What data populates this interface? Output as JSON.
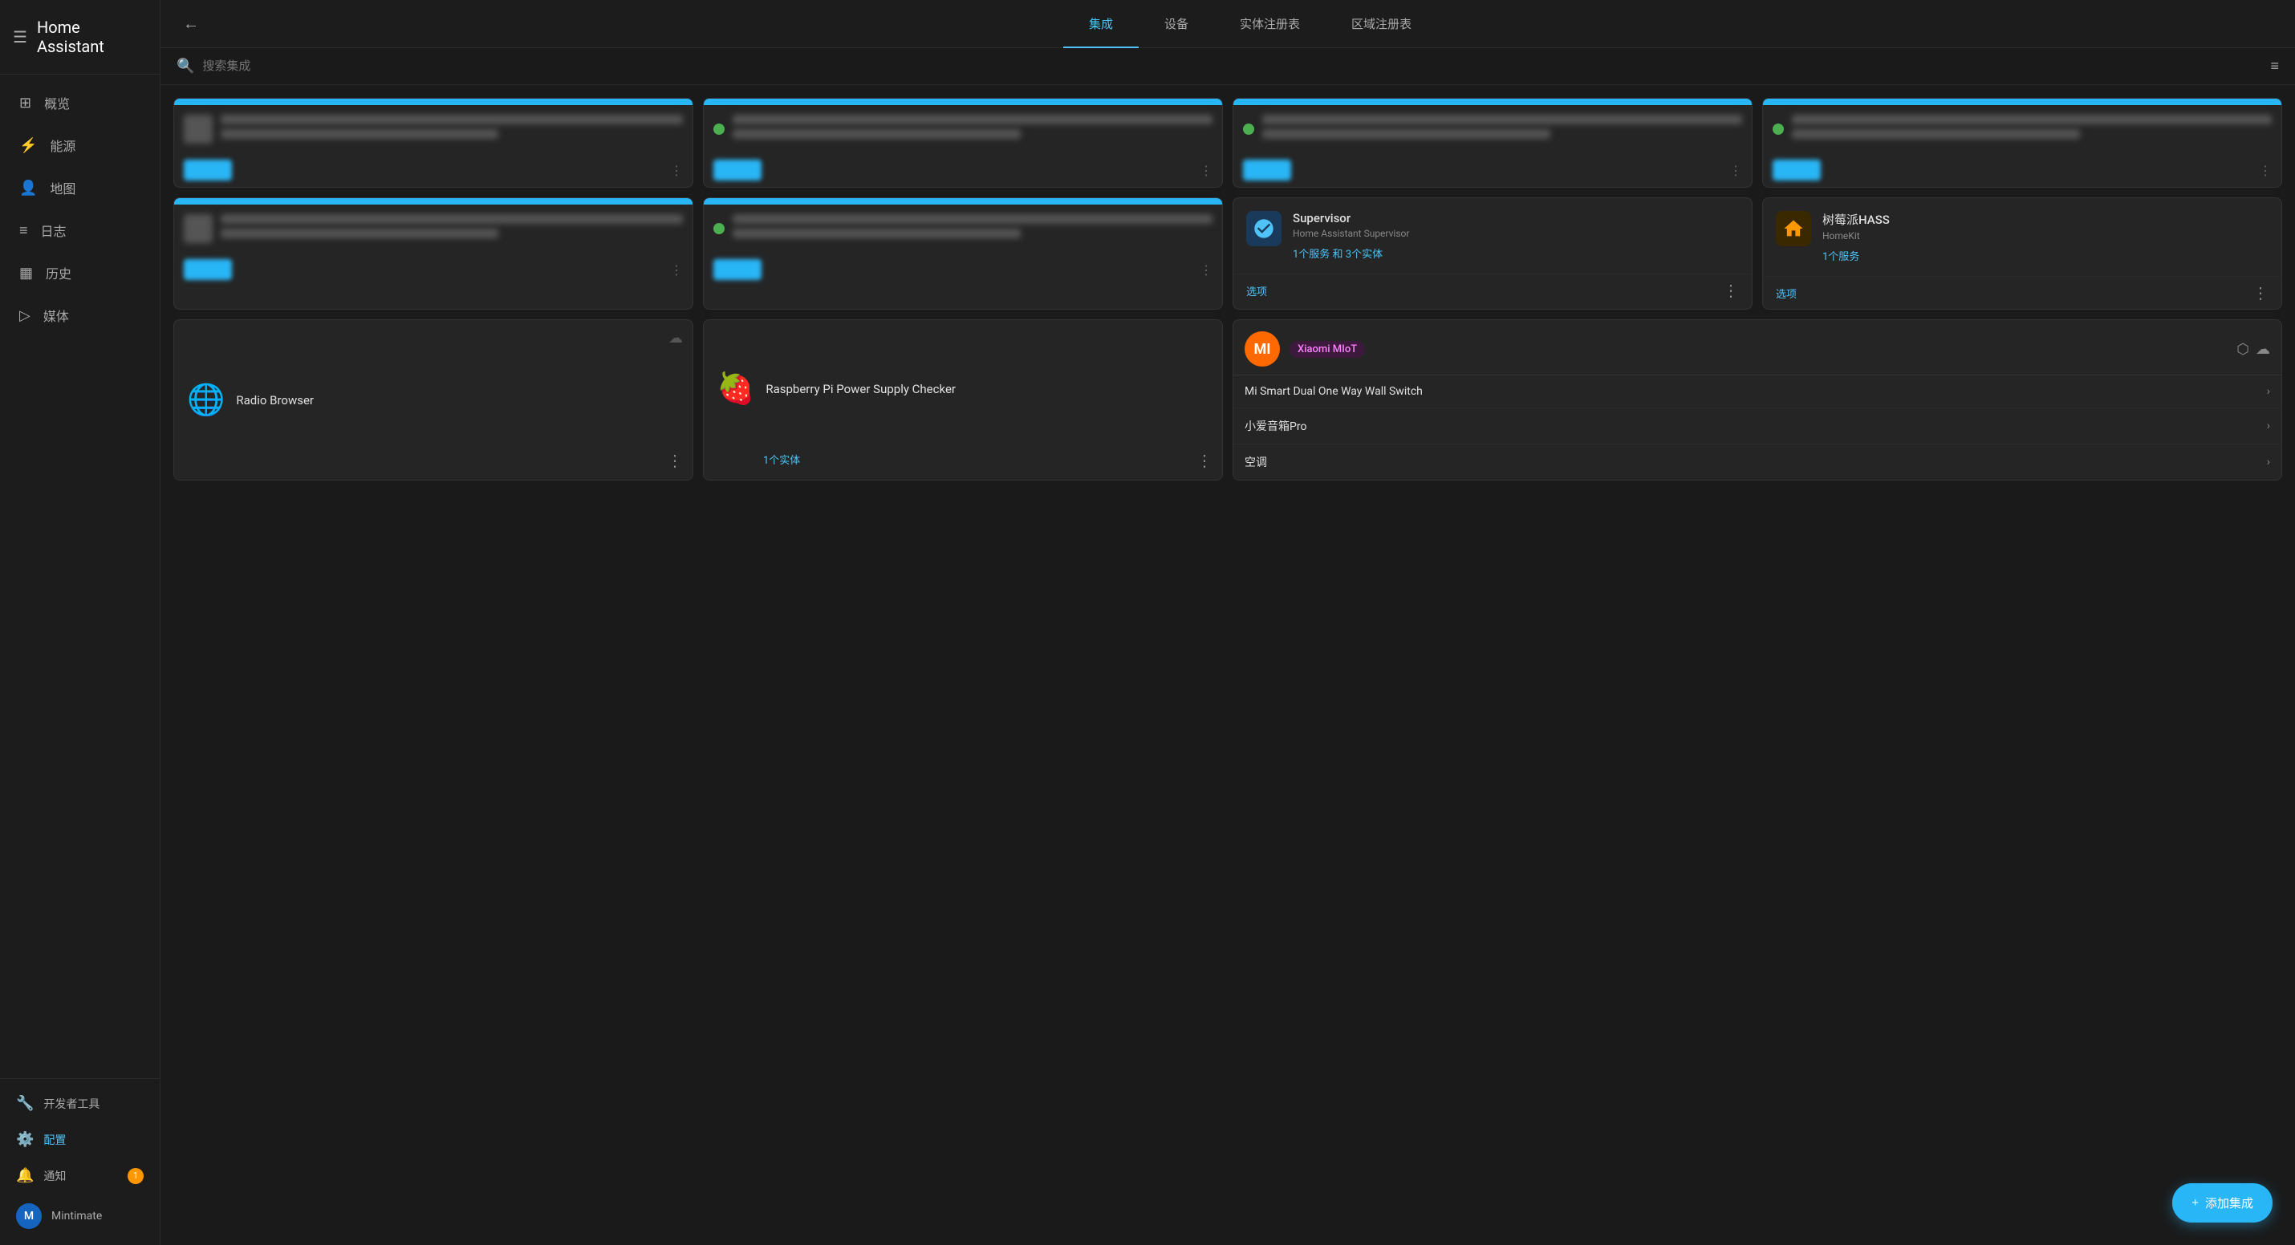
{
  "app": {
    "title": "Home Assistant"
  },
  "sidebar": {
    "menu_icon": "☰",
    "nav_items": [
      {
        "id": "overview",
        "label": "概览",
        "icon": "⊞"
      },
      {
        "id": "energy",
        "label": "能源",
        "icon": "⚡"
      },
      {
        "id": "map",
        "label": "地图",
        "icon": "👤"
      },
      {
        "id": "logs",
        "label": "日志",
        "icon": "☰"
      },
      {
        "id": "history",
        "label": "历史",
        "icon": "▦"
      },
      {
        "id": "media",
        "label": "媒体",
        "icon": "▷"
      }
    ],
    "footer_items": [
      {
        "id": "dev-tools",
        "label": "开发者工具",
        "icon": "🔧"
      },
      {
        "id": "config",
        "label": "配置",
        "icon": "⚙️",
        "active": true
      }
    ],
    "notification": {
      "label": "通知",
      "icon": "🔔",
      "badge": "1"
    },
    "user": {
      "name": "Mintimate",
      "avatar_letter": "M"
    }
  },
  "top_nav": {
    "back_icon": "←",
    "tabs": [
      {
        "id": "integrations",
        "label": "集成",
        "active": true
      },
      {
        "id": "devices",
        "label": "设备"
      },
      {
        "id": "entity-registry",
        "label": "实体注册表"
      },
      {
        "id": "area-registry",
        "label": "区域注册表"
      }
    ]
  },
  "search": {
    "placeholder": "搜索集成",
    "filter_icon": "filter"
  },
  "cards": {
    "blurred": [
      {
        "id": "b1",
        "has_green_dot": false
      },
      {
        "id": "b2",
        "has_green_dot": true
      },
      {
        "id": "b3",
        "has_green_dot": true
      },
      {
        "id": "b4",
        "has_green_dot": true
      },
      {
        "id": "b5",
        "has_green_dot": false
      },
      {
        "id": "b6",
        "has_green_dot": true
      }
    ],
    "supervisor": {
      "name": "Supervisor",
      "subtitle": "Home Assistant Supervisor",
      "links_text": "1个服务",
      "links_and": " 和 ",
      "links_entities": "3个实体",
      "options_label": "选项"
    },
    "homekit": {
      "name": "树莓派HASS",
      "subtitle": "HomeKit",
      "links_text": "1个服务",
      "options_label": "选项"
    },
    "radio_browser": {
      "name": "Radio Browser",
      "cloud_icon": "☁"
    },
    "raspberry_pi": {
      "name": "Raspberry Pi Power Supply Checker",
      "entity_link": "1个实体",
      "cloud_icon": "☁"
    },
    "xiaomi": {
      "brand": "MI",
      "name": "Xiaomi MIoT",
      "box_icon": "⬡",
      "cloud_icon": "☁",
      "devices": [
        {
          "name": "Mi Smart Dual One Way Wall Switch"
        },
        {
          "name": "小爱音箱Pro"
        },
        {
          "name": "空调"
        }
      ]
    }
  },
  "add_button": {
    "label": "添加集成",
    "icon": "+"
  }
}
